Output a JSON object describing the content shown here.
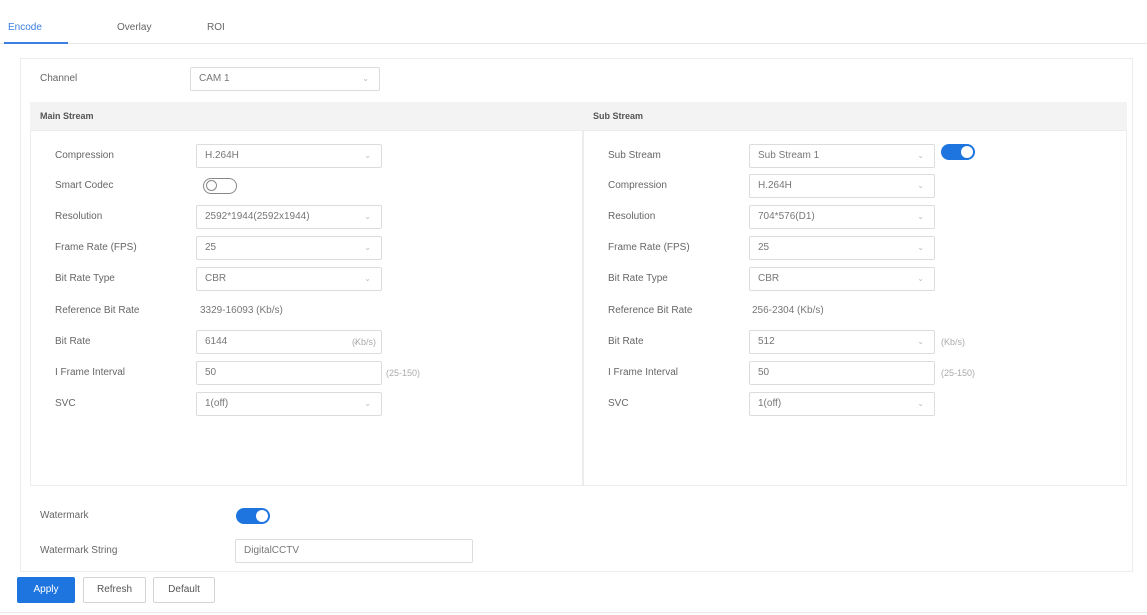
{
  "tabs": [
    {
      "label": "Encode",
      "active": true
    },
    {
      "label": "Overlay",
      "active": false
    },
    {
      "label": "ROI",
      "active": false
    }
  ],
  "channel": {
    "label": "Channel",
    "value": "CAM 1"
  },
  "main_stream": {
    "title": "Main Stream",
    "compression": {
      "label": "Compression",
      "value": "H.264H"
    },
    "smart_codec": {
      "label": "Smart Codec",
      "enabled": false
    },
    "resolution": {
      "label": "Resolution",
      "value": "2592*1944(2592x1944)"
    },
    "frame_rate": {
      "label": "Frame Rate (FPS)",
      "value": "25"
    },
    "bit_rate_type": {
      "label": "Bit Rate Type",
      "value": "CBR"
    },
    "reference_bit_rate": {
      "label": "Reference Bit Rate",
      "value": "3329-16093 (Kb/s)"
    },
    "bit_rate": {
      "label": "Bit Rate",
      "value": "6144",
      "unit": "(Kb/s)"
    },
    "i_frame_interval": {
      "label": "I Frame Interval",
      "value": "50",
      "range": "(25-150)"
    },
    "svc": {
      "label": "SVC",
      "value": "1(off)"
    }
  },
  "sub_stream": {
    "title": "Sub Stream",
    "sub_stream": {
      "label": "Sub Stream",
      "value": "Sub Stream 1",
      "enabled": true
    },
    "compression": {
      "label": "Compression",
      "value": "H.264H"
    },
    "resolution": {
      "label": "Resolution",
      "value": "704*576(D1)"
    },
    "frame_rate": {
      "label": "Frame Rate (FPS)",
      "value": "25"
    },
    "bit_rate_type": {
      "label": "Bit Rate Type",
      "value": "CBR"
    },
    "reference_bit_rate": {
      "label": "Reference Bit Rate",
      "value": "256-2304 (Kb/s)"
    },
    "bit_rate": {
      "label": "Bit Rate",
      "value": "512",
      "unit": "(Kb/s)"
    },
    "i_frame_interval": {
      "label": "I Frame Interval",
      "value": "50",
      "range": "(25-150)"
    },
    "svc": {
      "label": "SVC",
      "value": "1(off)"
    }
  },
  "watermark": {
    "label": "Watermark",
    "enabled": true
  },
  "watermark_string": {
    "label": "Watermark String",
    "value": "DigitalCCTV"
  },
  "buttons": {
    "apply": "Apply",
    "refresh": "Refresh",
    "default": "Default"
  },
  "colors": {
    "accent": "#1e75e0",
    "tab_active": "#3b7fe0",
    "header_bg": "#f3f3f3"
  },
  "icons": {
    "dropdown": "chevron-down-icon"
  }
}
